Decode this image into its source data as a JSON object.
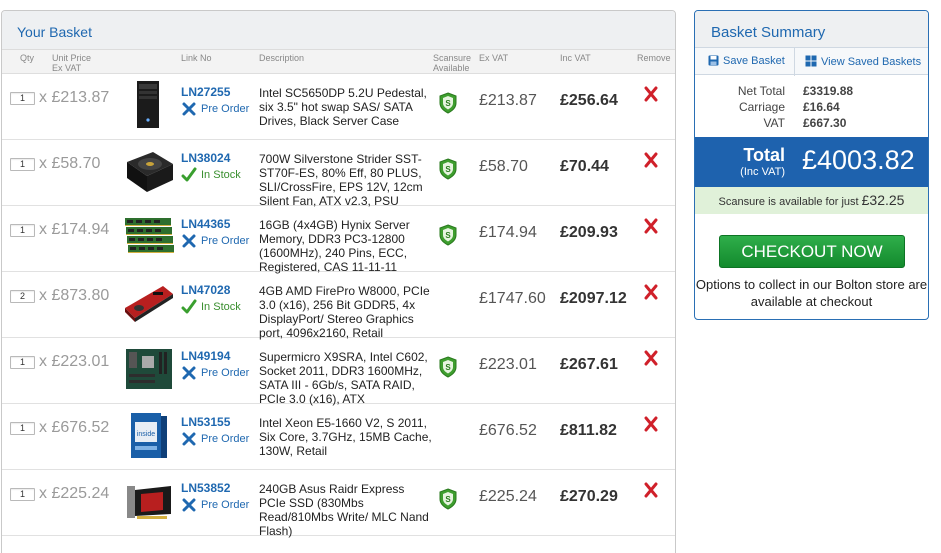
{
  "basket": {
    "title": "Your Basket",
    "headers": {
      "qty": "Qty",
      "unit_price": "Unit Price",
      "unit_price_sub": "Ex VAT",
      "link_no": "Link No",
      "description": "Description",
      "scansure": "Scansure",
      "scansure_sub": "Available",
      "ex_vat": "Ex VAT",
      "inc_vat": "Inc VAT",
      "remove": "Remove"
    },
    "items": [
      {
        "qty": "1",
        "x": "x",
        "unit": "£213.87",
        "link": "LN27255",
        "stock": "Pre Order",
        "stock_type": "pre",
        "desc": "Intel SC5650DP 5.2U Pedestal, six 3.5\" hot swap SAS/ SATA Drives, Black Server Case",
        "scansure": true,
        "ex": "£213.87",
        "inc": "£256.64",
        "product_icon": "server-case-icon"
      },
      {
        "qty": "1",
        "x": "x",
        "unit": "£58.70",
        "link": "LN38024",
        "stock": "In Stock",
        "stock_type": "in",
        "desc": "700W Silverstone Strider SST-ST70F-ES, 80% Eff, 80 PLUS, SLI/CrossFire, EPS 12V, 12cm Silent Fan, ATX v2.3, PSU",
        "scansure": true,
        "ex": "£58.70",
        "inc": "£70.44",
        "product_icon": "psu-icon"
      },
      {
        "qty": "1",
        "x": "x",
        "unit": "£174.94",
        "link": "LN44365",
        "stock": "Pre Order",
        "stock_type": "pre",
        "desc": "16GB (4x4GB) Hynix Server Memory, DDR3 PC3-12800 (1600MHz), 240 Pins, ECC, Registered, CAS 11-11-11",
        "scansure": true,
        "ex": "£174.94",
        "inc": "£209.93",
        "product_icon": "memory-icon"
      },
      {
        "qty": "2",
        "x": "x",
        "unit": "£873.80",
        "link": "LN47028",
        "stock": "In Stock",
        "stock_type": "in",
        "desc": "4GB AMD FirePro W8000, PCIe 3.0 (x16), 256 Bit GDDR5, 4x DisplayPort/ Stereo Graphics port, 4096x2160, Retail",
        "scansure": false,
        "ex": "£1747.60",
        "inc": "£2097.12",
        "product_icon": "graphics-card-icon"
      },
      {
        "qty": "1",
        "x": "x",
        "unit": "£223.01",
        "link": "LN49194",
        "stock": "Pre Order",
        "stock_type": "pre",
        "desc": "Supermicro X9SRA, Intel C602, Socket 2011, DDR3 1600MHz, SATA III - 6Gb/s, SATA RAID, PCIe 3.0 (x16), ATX",
        "scansure": true,
        "ex": "£223.01",
        "inc": "£267.61",
        "product_icon": "motherboard-icon"
      },
      {
        "qty": "1",
        "x": "x",
        "unit": "£676.52",
        "link": "LN53155",
        "stock": "Pre Order",
        "stock_type": "pre",
        "desc": "Intel Xeon E5-1660 V2, S 2011, Six Core, 3.7GHz, 15MB Cache, 130W, Retail",
        "scansure": false,
        "ex": "£676.52",
        "inc": "£811.82",
        "product_icon": "cpu-box-icon"
      },
      {
        "qty": "1",
        "x": "x",
        "unit": "£225.24",
        "link": "LN53852",
        "stock": "Pre Order",
        "stock_type": "pre",
        "desc": "240GB Asus Raidr Express PCIe SSD (830Mbs Read/810Mbs Write/ MLC Nand Flash)",
        "scansure": true,
        "ex": "£225.24",
        "inc": "£270.29",
        "product_icon": "pcie-ssd-icon"
      }
    ]
  },
  "summary": {
    "title": "Basket Summary",
    "save_label": "Save Basket",
    "view_label": "View Saved Baskets",
    "net_label": "Net Total",
    "net_value": "£3319.88",
    "carriage_label": "Carriage",
    "carriage_value": "£16.64",
    "vat_label": "VAT",
    "vat_value": "£667.30",
    "total_label": "Total",
    "total_sub": "(Inc VAT)",
    "total_value": "£4003.82",
    "scansure_text": "Scansure is available for just",
    "scansure_amount": "£32.25",
    "checkout_label": "CHECKOUT NOW",
    "collect_text": "Options to collect in our Bolton store are available at checkout"
  },
  "colors": {
    "brand_blue": "#1f68b0",
    "total_bar": "#1e62ae",
    "checkout_green": "#138a2d",
    "remove_red": "#d0202a",
    "scansure_bg": "#e0f1d9"
  }
}
